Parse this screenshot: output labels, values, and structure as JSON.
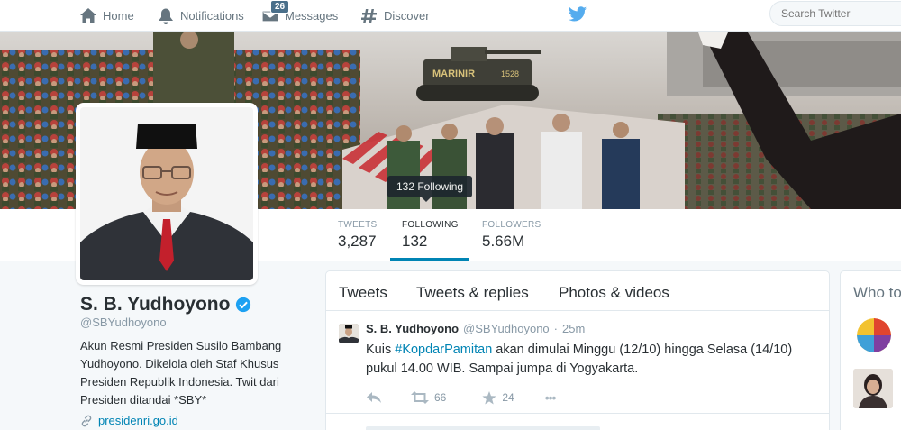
{
  "nav": {
    "home": "Home",
    "notifications": "Notifications",
    "messages": "Messages",
    "messages_count": "26",
    "discover": "Discover",
    "search_placeholder": "Search Twitter"
  },
  "banner": {
    "tooltip": "132 Following",
    "tank_label": "MARINIR",
    "tank_number": "1528"
  },
  "stats": {
    "tweets_label": "TWEETS",
    "tweets_value": "3,287",
    "following_label": "FOLLOWING",
    "following_value": "132",
    "followers_label": "FOLLOWERS",
    "followers_value": "5.66M"
  },
  "profile": {
    "name": "S. B. Yudhoyono",
    "handle": "@SBYudhoyono",
    "bio": "Akun Resmi Presiden Susilo Bambang Yudhoyono. Dikelola oleh Staf Khusus Presiden Republik Indonesia. Twit dari Presiden ditandai *SBY*",
    "website": "presidenri.go.id"
  },
  "timeline": {
    "tabs": [
      "Tweets",
      "Tweets & replies",
      "Photos & videos"
    ],
    "tweet": {
      "name": "S. B. Yudhoyono",
      "handle": "@SBYudhoyono",
      "separator": "·",
      "time": "25m",
      "text_before": "Kuis ",
      "hashtag": "#KopdarPamitan",
      "text_after": " akan dimulai Minggu (12/10) hingga Selasa (14/10) pukul 14.00 WIB. Sampai jumpa di Yogyakarta.",
      "retweets": "66",
      "favorites": "24",
      "more": "•••"
    }
  },
  "sidebar": {
    "who_to_follow": "Who to"
  },
  "colors": {
    "accent": "#0084b4",
    "twitter_blue": "#55acee",
    "verified": "#1da1f2"
  }
}
